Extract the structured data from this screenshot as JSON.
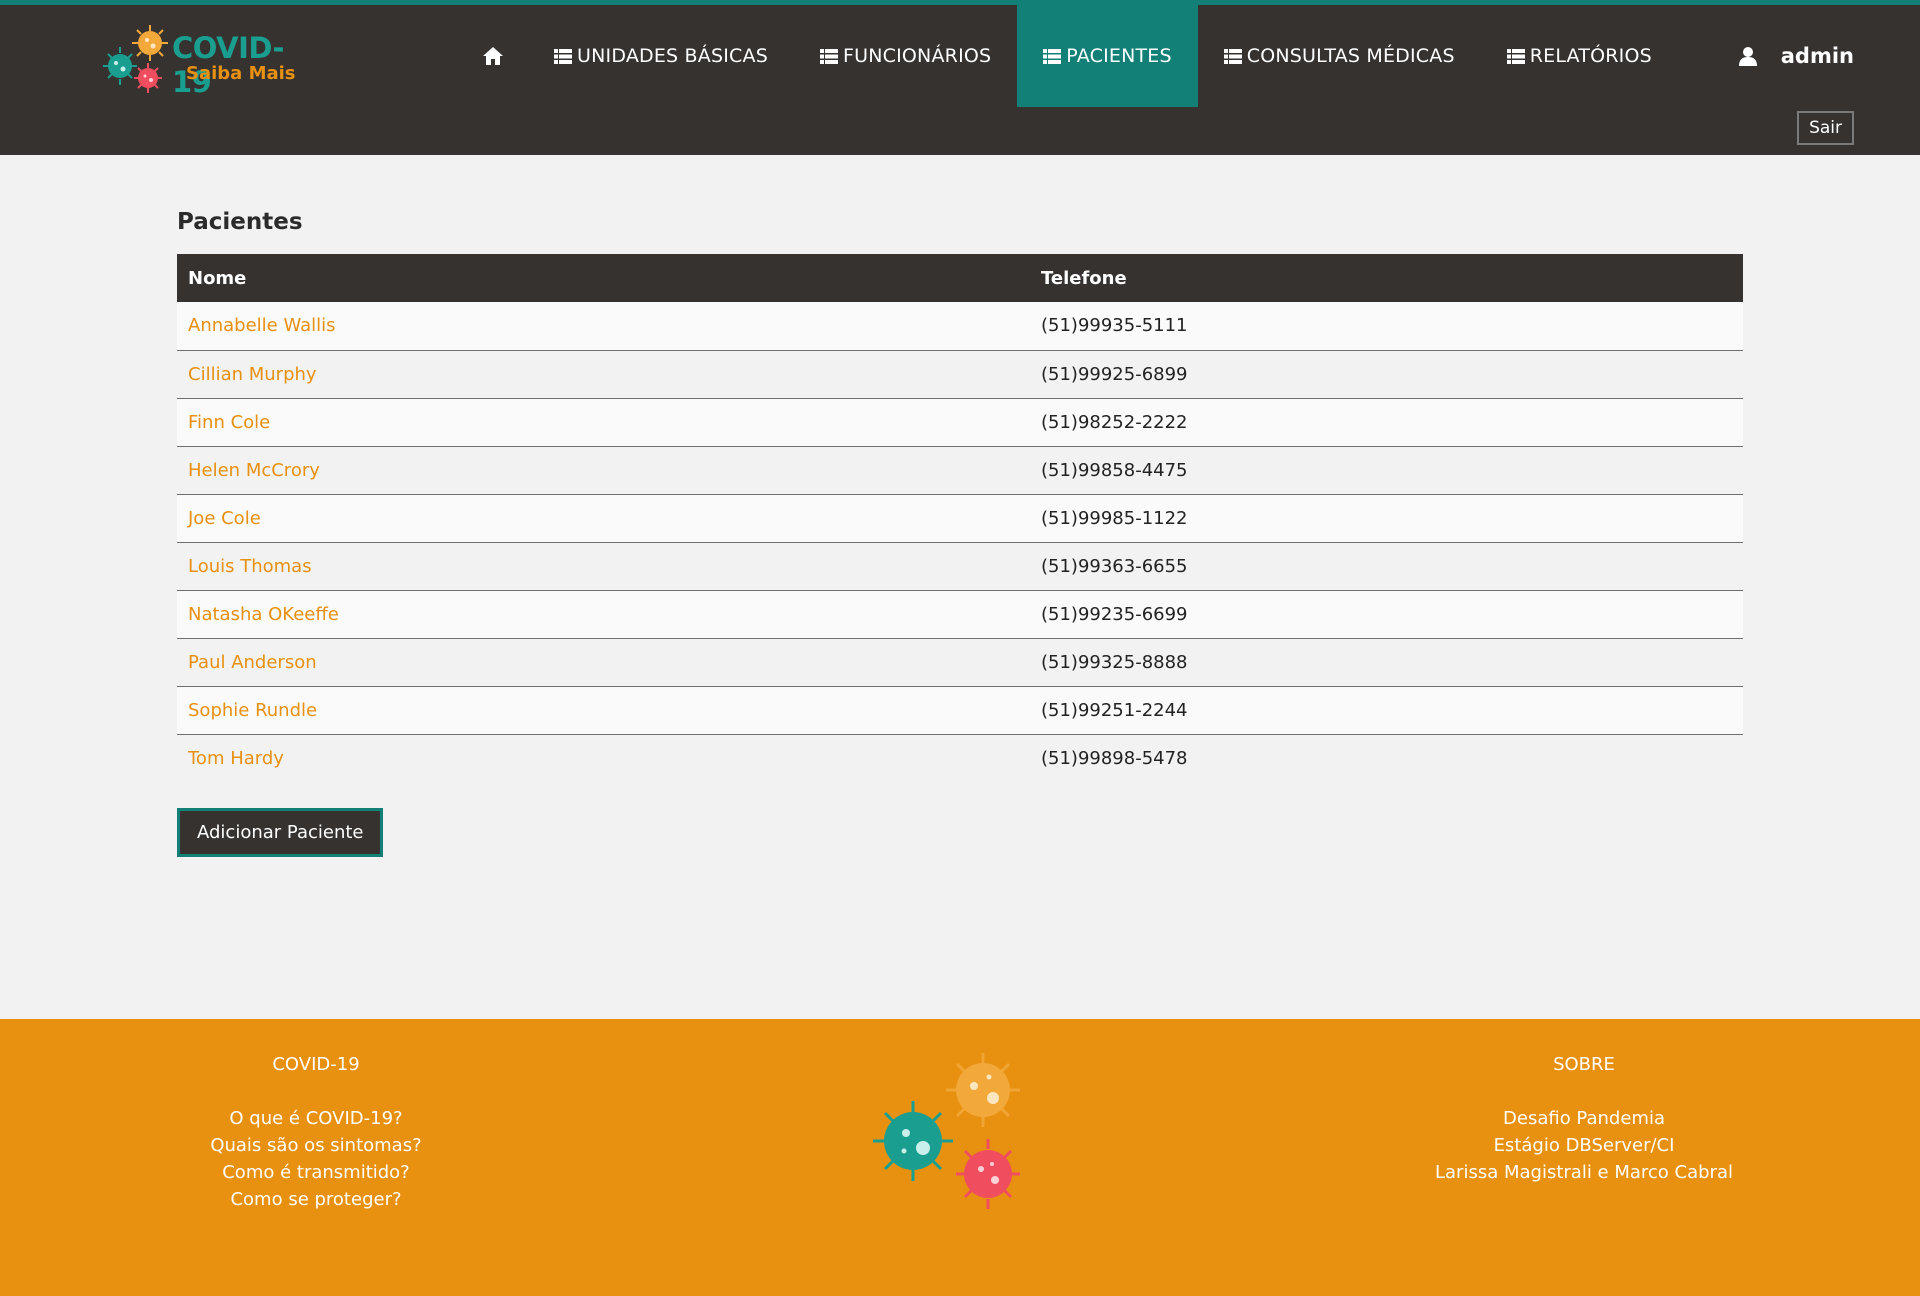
{
  "header": {
    "logo_title": "COVID-19",
    "logo_subtitle": "Saiba Mais",
    "nav": [
      {
        "label": "UNIDADES BÁSICAS"
      },
      {
        "label": "FUNCIONÁRIOS"
      },
      {
        "label": "PACIENTES",
        "active": true
      },
      {
        "label": "CONSULTAS MÉDICAS"
      },
      {
        "label": "RELATÓRIOS"
      }
    ],
    "user": "admin",
    "logout_label": "Sair"
  },
  "main": {
    "title": "Pacientes",
    "columns": [
      "Nome",
      "Telefone"
    ],
    "rows": [
      {
        "name": "Annabelle Wallis",
        "phone": "(51)99935-5111"
      },
      {
        "name": "Cillian Murphy",
        "phone": "(51)99925-6899"
      },
      {
        "name": "Finn Cole",
        "phone": "(51)98252-2222"
      },
      {
        "name": "Helen McCrory",
        "phone": "(51)99858-4475"
      },
      {
        "name": "Joe Cole",
        "phone": "(51)99985-1122"
      },
      {
        "name": "Louis Thomas",
        "phone": "(51)99363-6655"
      },
      {
        "name": "Natasha OKeeffe",
        "phone": "(51)99235-6699"
      },
      {
        "name": "Paul Anderson",
        "phone": "(51)99325-8888"
      },
      {
        "name": "Sophie Rundle",
        "phone": "(51)99251-2244"
      },
      {
        "name": "Tom Hardy",
        "phone": "(51)99898-5478"
      }
    ],
    "add_button": "Adicionar Paciente"
  },
  "footer": {
    "left": {
      "title": "COVID-19",
      "links": [
        "O que é COVID-19?",
        "Quais são os sintomas?",
        "Como é transmitido?",
        "Como se proteger?"
      ]
    },
    "right": {
      "title": "SOBRE",
      "lines": [
        "Desafio Pandemia",
        "Estágio DBServer/CI",
        "Larissa Magistrali e Marco Cabral"
      ]
    }
  },
  "colors": {
    "header_bg": "#353230",
    "accent_teal": "#138078",
    "link_orange": "#e8900f",
    "footer_bg": "#e8900f",
    "virus_red": "#f04e5e",
    "virus_orange": "#f3a83a"
  },
  "icons": {
    "home": "home-icon",
    "list": "list-icon",
    "user": "user-icon",
    "logo": "virus-logo-icon"
  }
}
